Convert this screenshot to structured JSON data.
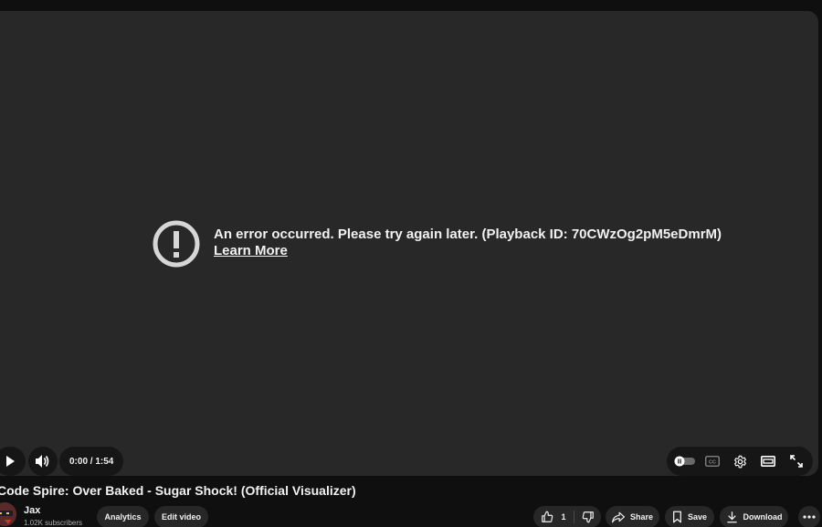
{
  "player": {
    "error_message": "An error occurred. Please try again later. (Playback ID: 70CWzOg2pM5eDmrM)",
    "error_link": "Learn More",
    "time_display": "0:00 / 1:54",
    "icons": {
      "error": "exclamation-circle-icon",
      "play": "play-icon",
      "volume": "volume-icon",
      "autoplay": "autoplay-toggle-icon",
      "captions": "captions-icon",
      "settings": "gear-icon",
      "theater": "theater-mode-icon",
      "fullscreen": "fullscreen-icon"
    }
  },
  "video": {
    "title": "Code Spire: Over Baked - Sugar Shock! (Official Visualizer)"
  },
  "channel": {
    "name": "Jax",
    "subscribers": "1.02K subscribers"
  },
  "actions": {
    "analytics_label": "Analytics",
    "edit_label": "Edit video",
    "like_count": "1",
    "share_label": "Share",
    "save_label": "Save",
    "download_label": "Download"
  },
  "colors": {
    "page_bg": "#0f0f0f",
    "player_bg": "#282828",
    "button_bg": "#272727",
    "text_primary": "#f1f1f1",
    "text_secondary": "#aaaaaa"
  }
}
